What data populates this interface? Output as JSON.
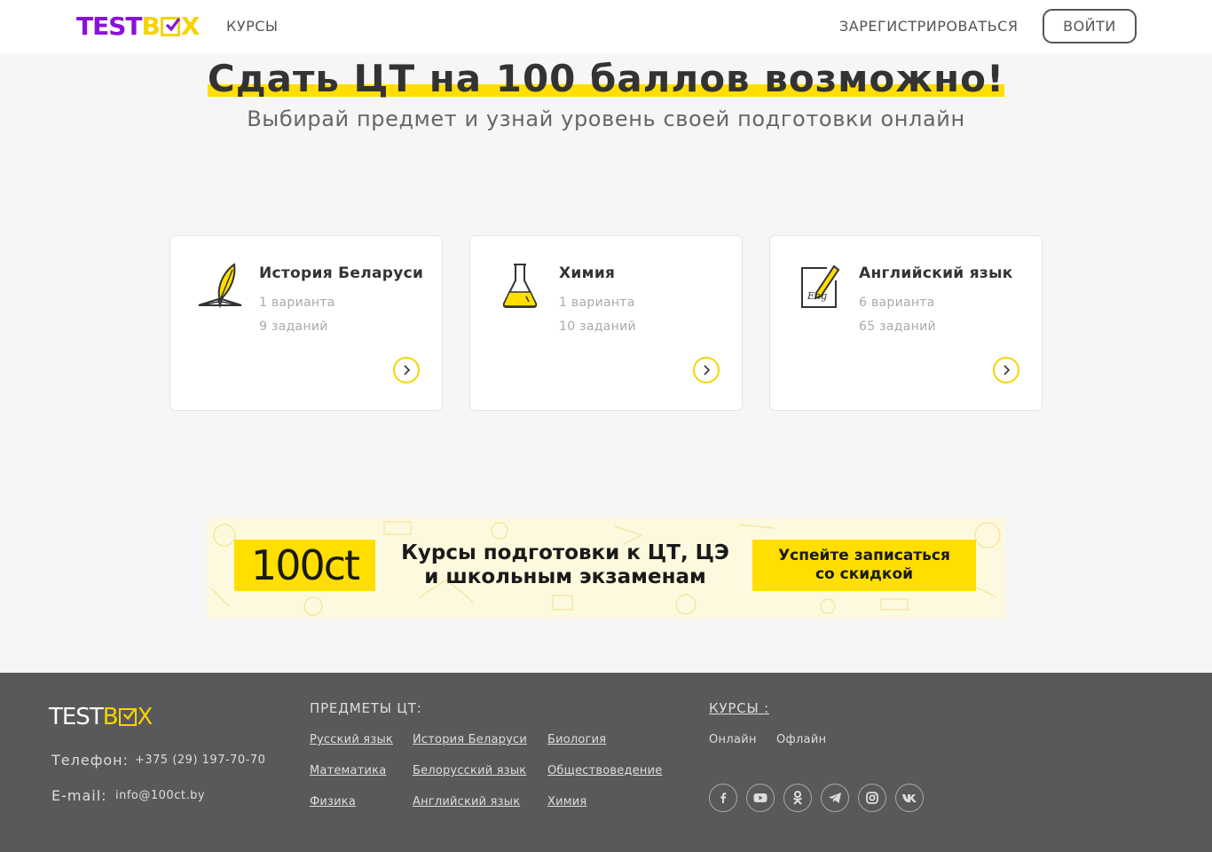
{
  "header": {
    "logo_part1": "TEST",
    "logo_part2": "B",
    "logo_part3": "X",
    "nav_courses": "КУРСЫ",
    "register": "ЗАРЕГИСТРИРОВАТЬСЯ",
    "login": "ВОЙТИ"
  },
  "hero": {
    "title": "Сдать ЦТ на 100 баллов возможно!",
    "subtitle": "Выбирай предмет и узнай уровень своей подготовки онлайн"
  },
  "cards": [
    {
      "title": "История Беларуси",
      "variants": "1 варианта",
      "tasks": "9 заданий",
      "icon": "quill-book-icon"
    },
    {
      "title": "Химия",
      "variants": "1 варианта",
      "tasks": "10 заданий",
      "icon": "flask-icon"
    },
    {
      "title": "Английский язык",
      "variants": "6 варианта",
      "tasks": "65 заданий",
      "icon": "eng-pencil-icon",
      "icon_text": "Eng"
    }
  ],
  "banner": {
    "logo": "100ct",
    "line1": "Курсы подготовки к ЦТ, ЦЭ",
    "line2": "и школьным экзаменам",
    "cta_line1": "Успейте записаться",
    "cta_line2": "со скидкой"
  },
  "footer": {
    "logo_part1": "TEST",
    "logo_part2": "B",
    "logo_part3": "X",
    "phone_label": "Телефон:",
    "phone": "+375 (29) 197-70-70",
    "email_label": "E-mail:",
    "email": "info@100ct.by",
    "subjects_heading": "ПРЕДМЕТЫ ЦТ:",
    "subjects": [
      "Русский язык",
      "История Беларуси",
      "Биология",
      "Математика",
      "Белорусский язык",
      "Обществоведение",
      "Физика",
      "Английский язык",
      "Химия"
    ],
    "courses_heading": "КУРСЫ :",
    "courses": [
      "Онлайн",
      "Офлайн"
    ],
    "socials": [
      "facebook-icon",
      "youtube-icon",
      "odnoklassniki-icon",
      "telegram-icon",
      "instagram-icon",
      "vk-icon"
    ]
  },
  "colors": {
    "brand_purple": "#8a12d6",
    "brand_yellow": "#ffde00",
    "footer_bg": "#59595c"
  }
}
